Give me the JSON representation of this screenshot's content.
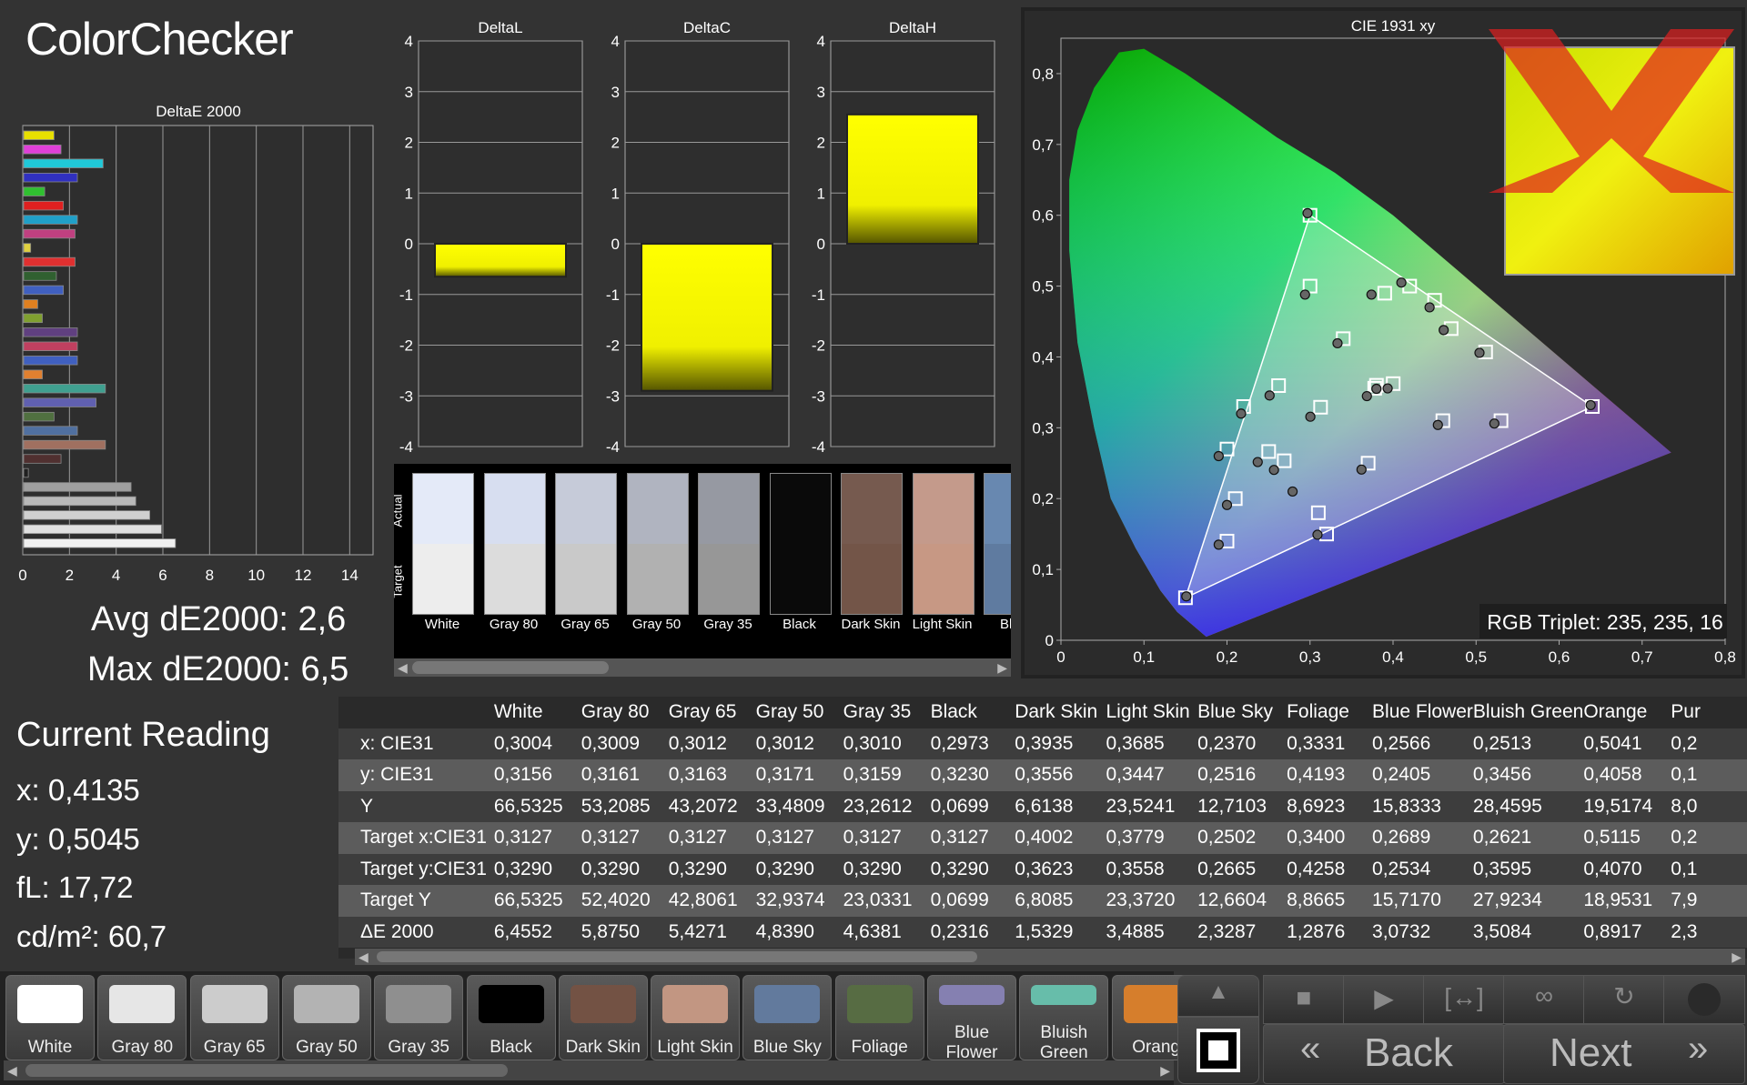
{
  "title": "ColorChecker",
  "summary": {
    "avg": "Avg dE2000: 2,6",
    "max": "Max dE2000: 6,5"
  },
  "current_reading": {
    "title": "Current Reading",
    "x": "x: 0,4135",
    "y": "y: 0,5045",
    "fl": "fL: 17,72",
    "cdm2": "cd/m²: 60,7"
  },
  "rgb_triplet": "RGB Triplet: 235, 235, 16",
  "chart_data": [
    {
      "type": "bar",
      "orientation": "horizontal",
      "title": "DeltaE 2000",
      "xlim": [
        0,
        15
      ],
      "xticks": [
        "0",
        "2",
        "4",
        "6",
        "8",
        "10",
        "12",
        "14"
      ],
      "values": [
        1.3,
        1.6,
        3.4,
        2.3,
        0.9,
        1.7,
        2.3,
        2.2,
        0.3,
        2.2,
        1.4,
        1.7,
        0.6,
        0.8,
        2.3,
        2.3,
        2.3,
        0.8,
        3.5,
        3.1,
        1.3,
        2.3,
        3.5,
        1.6,
        0.2,
        4.6,
        4.8,
        5.4,
        5.9,
        6.5
      ],
      "colors": [
        "#e8e000",
        "#e040d8",
        "#20c8d8",
        "#3030c0",
        "#30c030",
        "#e02020",
        "#20a0c8",
        "#c04080",
        "#e0d040",
        "#e03030",
        "#306030",
        "#4060c0",
        "#e08020",
        "#80a030",
        "#604080",
        "#c04060",
        "#4060c0",
        "#e08030",
        "#40a090",
        "#6060b0",
        "#507040",
        "#5070a0",
        "#a07060",
        "#503030",
        "#202020",
        "#a0a0a0",
        "#b8b8b8",
        "#d0d0d0",
        "#e0e0e0",
        "#f0f0f0"
      ]
    },
    {
      "type": "bar",
      "title": "DeltaL",
      "ylim": [
        -4,
        4
      ],
      "yticks": [
        "4",
        "3",
        "2",
        "1",
        "0",
        "-1",
        "-2",
        "-3",
        "-4"
      ],
      "values": [
        -0.65
      ]
    },
    {
      "type": "bar",
      "title": "DeltaC",
      "ylim": [
        -4,
        4
      ],
      "yticks": [
        "4",
        "3",
        "2",
        "1",
        "0",
        "-1",
        "-2",
        "-3",
        "-4"
      ],
      "values": [
        -2.9
      ]
    },
    {
      "type": "bar",
      "title": "DeltaH",
      "ylim": [
        -4,
        4
      ],
      "yticks": [
        "4",
        "3",
        "2",
        "1",
        "0",
        "-1",
        "-2",
        "-3",
        "-4"
      ],
      "values": [
        2.55
      ]
    },
    {
      "type": "scatter",
      "title": "CIE 1931 xy",
      "xlim": [
        0,
        0.8
      ],
      "ylim": [
        0,
        0.85
      ],
      "xticks": [
        "0",
        "0,1",
        "0,2",
        "0,3",
        "0,4",
        "0,5",
        "0,6",
        "0,7",
        "0,8"
      ],
      "yticks": [
        "0",
        "0,1",
        "0,2",
        "0,3",
        "0,4",
        "0,5",
        "0,6",
        "0,7",
        "0,8"
      ],
      "gamut_triangle": [
        [
          0.64,
          0.33
        ],
        [
          0.3,
          0.6
        ],
        [
          0.15,
          0.06
        ]
      ],
      "targets": [
        [
          0.3,
          0.6
        ],
        [
          0.64,
          0.33
        ],
        [
          0.15,
          0.06
        ],
        [
          0.22,
          0.33
        ],
        [
          0.32,
          0.15
        ],
        [
          0.42,
          0.5
        ],
        [
          0.3127,
          0.329
        ],
        [
          0.4002,
          0.3623
        ],
        [
          0.3779,
          0.3558
        ],
        [
          0.2502,
          0.2665
        ],
        [
          0.34,
          0.4258
        ],
        [
          0.2689,
          0.2534
        ],
        [
          0.2621,
          0.3595
        ],
        [
          0.5115,
          0.407
        ],
        [
          0.2,
          0.14
        ],
        [
          0.46,
          0.31
        ],
        [
          0.39,
          0.49
        ],
        [
          0.47,
          0.44
        ],
        [
          0.53,
          0.31
        ],
        [
          0.21,
          0.2
        ],
        [
          0.37,
          0.25
        ],
        [
          0.3,
          0.5
        ],
        [
          0.2,
          0.27
        ],
        [
          0.31,
          0.18
        ],
        [
          0.45,
          0.48
        ],
        [
          0.38,
          0.36
        ]
      ],
      "actuals": [
        [
          0.297,
          0.603
        ],
        [
          0.638,
          0.332
        ],
        [
          0.151,
          0.062
        ],
        [
          0.217,
          0.32
        ],
        [
          0.309,
          0.149
        ],
        [
          0.41,
          0.505
        ],
        [
          0.3004,
          0.3156
        ],
        [
          0.3935,
          0.3556
        ],
        [
          0.3685,
          0.3447
        ],
        [
          0.237,
          0.2516
        ],
        [
          0.3331,
          0.4193
        ],
        [
          0.2566,
          0.2405
        ],
        [
          0.2513,
          0.3456
        ],
        [
          0.5041,
          0.4058
        ],
        [
          0.19,
          0.135
        ],
        [
          0.454,
          0.304
        ],
        [
          0.374,
          0.488
        ],
        [
          0.461,
          0.438
        ],
        [
          0.522,
          0.306
        ],
        [
          0.2,
          0.191
        ],
        [
          0.362,
          0.241
        ],
        [
          0.294,
          0.488
        ],
        [
          0.19,
          0.26
        ],
        [
          0.279,
          0.21
        ],
        [
          0.444,
          0.47
        ],
        [
          0.38,
          0.355
        ]
      ]
    }
  ],
  "patch_panel": {
    "vertical_labels": [
      "Actual",
      "Target"
    ],
    "items": [
      {
        "label": "White",
        "actual": "#e4eaf8",
        "target": "#ededed"
      },
      {
        "label": "Gray 80",
        "actual": "#d7def0",
        "target": "#dcdcdc"
      },
      {
        "label": "Gray 65",
        "actual": "#c6cbd9",
        "target": "#c9c9c9"
      },
      {
        "label": "Gray 50",
        "actual": "#b0b4c0",
        "target": "#b1b1b1"
      },
      {
        "label": "Gray 35",
        "actual": "#9699a2",
        "target": "#979797"
      },
      {
        "label": "Black",
        "actual": "#0a0a0a",
        "target": "#0a0a0a"
      },
      {
        "label": "Dark Skin",
        "actual": "#765a4f",
        "target": "#735548"
      },
      {
        "label": "Light Skin",
        "actual": "#c49a8b",
        "target": "#c79884"
      },
      {
        "label": "Blue",
        "actual": "#6888b0",
        "target": "#5f7ba0"
      }
    ]
  },
  "table": {
    "headers": [
      "",
      "White",
      "Gray 80",
      "Gray 65",
      "Gray 50",
      "Gray 35",
      "Black",
      "Dark Skin",
      "Light Skin",
      "Blue Sky",
      "Foliage",
      "Blue Flower",
      "Bluish Green",
      "Orange",
      "Pur"
    ],
    "rows": [
      [
        "x: CIE31",
        "0,3004",
        "0,3009",
        "0,3012",
        "0,3012",
        "0,3010",
        "0,2973",
        "0,3935",
        "0,3685",
        "0,2370",
        "0,3331",
        "0,2566",
        "0,2513",
        "0,5041",
        "0,2"
      ],
      [
        "y: CIE31",
        "0,3156",
        "0,3161",
        "0,3163",
        "0,3171",
        "0,3159",
        "0,3230",
        "0,3556",
        "0,3447",
        "0,2516",
        "0,4193",
        "0,2405",
        "0,3456",
        "0,4058",
        "0,1"
      ],
      [
        "Y",
        "66,5325",
        "53,2085",
        "43,2072",
        "33,4809",
        "23,2612",
        "0,0699",
        "6,6138",
        "23,5241",
        "12,7103",
        "8,6923",
        "15,8333",
        "28,4595",
        "19,5174",
        "8,0"
      ],
      [
        "Target x:CIE31",
        "0,3127",
        "0,3127",
        "0,3127",
        "0,3127",
        "0,3127",
        "0,3127",
        "0,4002",
        "0,3779",
        "0,2502",
        "0,3400",
        "0,2689",
        "0,2621",
        "0,5115",
        "0,2"
      ],
      [
        "Target y:CIE31",
        "0,3290",
        "0,3290",
        "0,3290",
        "0,3290",
        "0,3290",
        "0,3290",
        "0,3623",
        "0,3558",
        "0,2665",
        "0,4258",
        "0,2534",
        "0,3595",
        "0,4070",
        "0,1"
      ],
      [
        "Target Y",
        "66,5325",
        "52,4020",
        "42,8061",
        "32,9374",
        "23,0331",
        "0,0699",
        "6,8085",
        "23,3720",
        "12,6604",
        "8,8665",
        "15,7170",
        "27,9234",
        "18,9531",
        "7,9"
      ],
      [
        "ΔE 2000",
        "6,4552",
        "5,8750",
        "5,4271",
        "4,8390",
        "4,6381",
        "0,2316",
        "1,5329",
        "3,4885",
        "2,3287",
        "1,2876",
        "3,0732",
        "3,5084",
        "0,8917",
        "2,3"
      ]
    ]
  },
  "patch_buttons": [
    {
      "label": "White",
      "color": "#ffffff"
    },
    {
      "label": "Gray 80",
      "color": "#e6e6e6"
    },
    {
      "label": "Gray 65",
      "color": "#cccccc"
    },
    {
      "label": "Gray 50",
      "color": "#b3b3b3"
    },
    {
      "label": "Gray 35",
      "color": "#8f8f8f"
    },
    {
      "label": "Black",
      "color": "#000000"
    },
    {
      "label": "Dark Skin",
      "color": "#735244"
    },
    {
      "label": "Light Skin",
      "color": "#c29682"
    },
    {
      "label": "Blue Sky",
      "color": "#627a9d"
    },
    {
      "label": "Foliage",
      "color": "#576c43"
    },
    {
      "label": "Blue Flower",
      "color": "#8580b1"
    },
    {
      "label": "Bluish Green",
      "color": "#67bdaa"
    },
    {
      "label": "Orang",
      "color": "#d67e2c"
    }
  ],
  "nav": {
    "back": "Back",
    "next": "Next"
  },
  "icons": {
    "stop": "stop-icon",
    "play": "play-icon",
    "fit": "fit-icon",
    "loop": "loop-icon",
    "refresh": "refresh-icon",
    "up": "chevron-up-icon",
    "square": "stop-square-icon"
  }
}
